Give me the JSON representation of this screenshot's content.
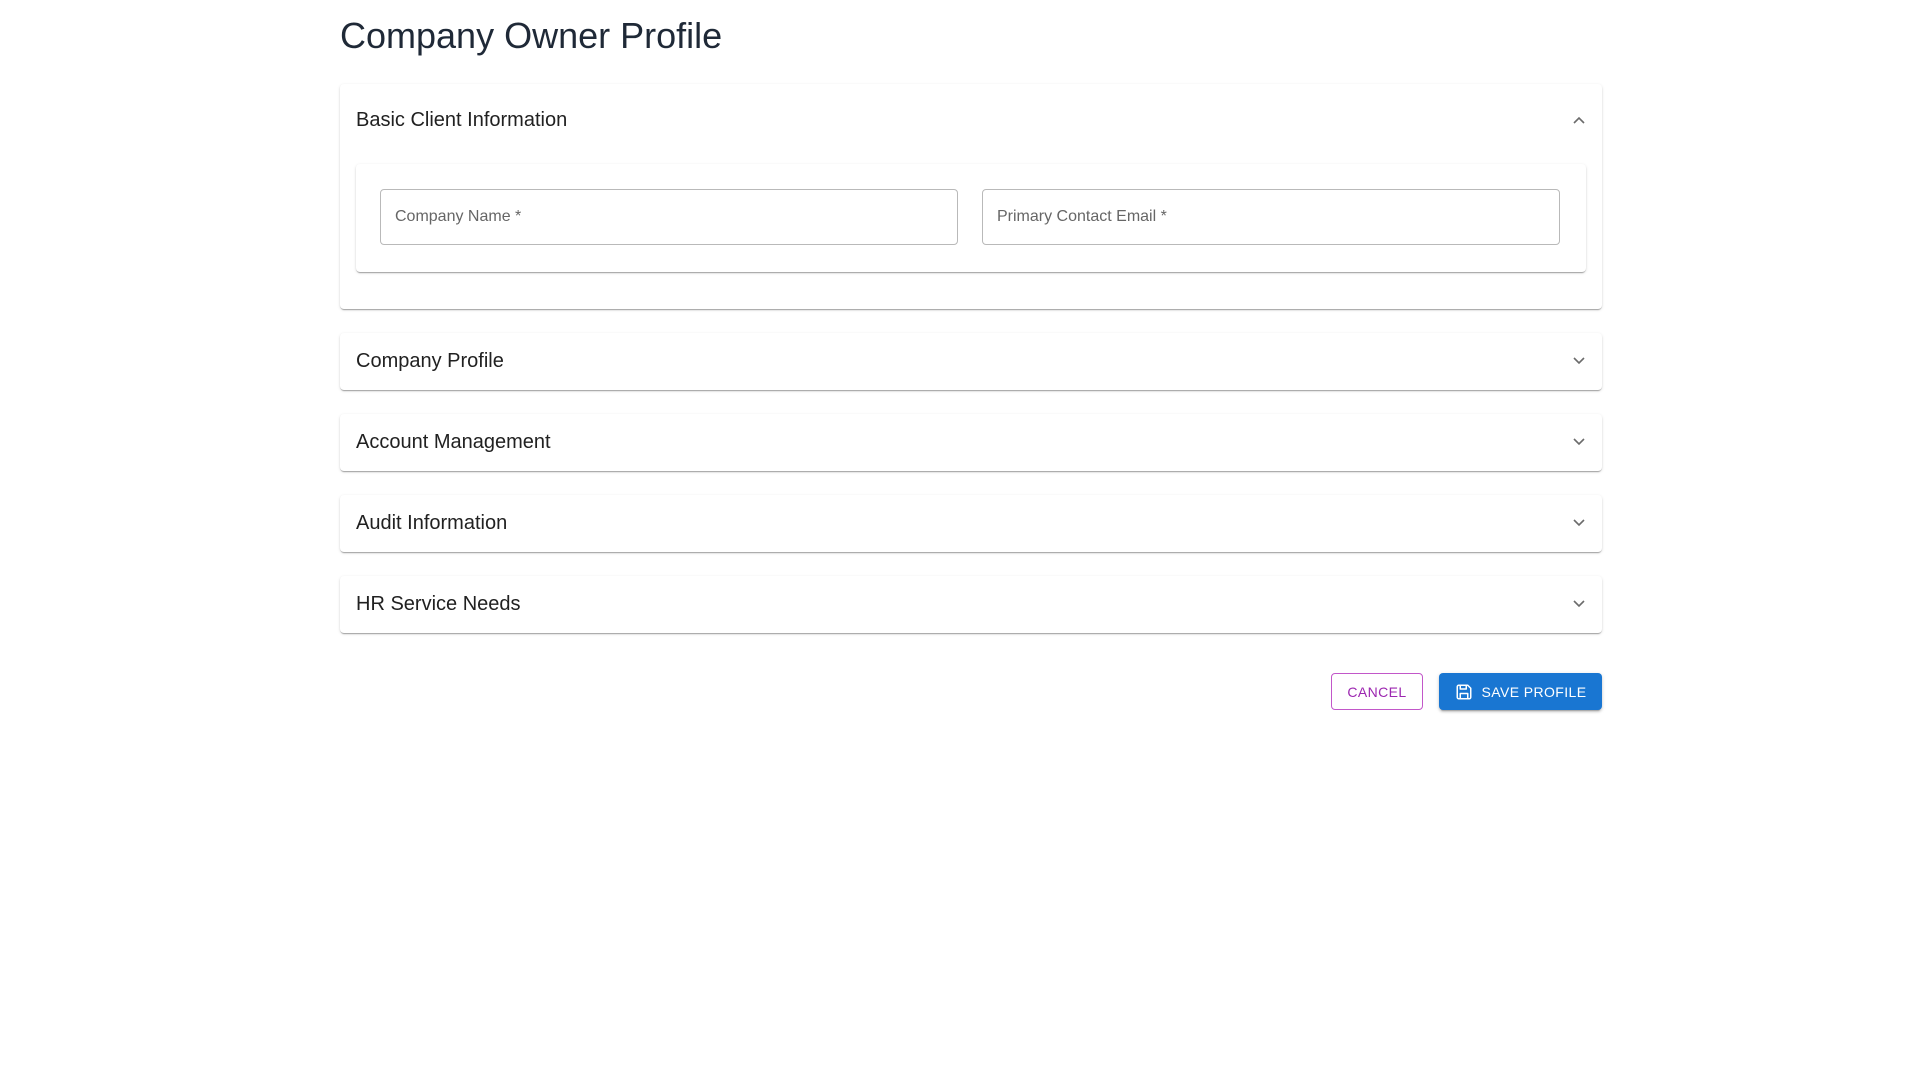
{
  "page": {
    "title": "Company Owner Profile"
  },
  "sections": [
    {
      "title": "Basic Client Information",
      "expanded": true,
      "fields": [
        {
          "label": "Company Name *",
          "value": ""
        },
        {
          "label": "Primary Contact Email *",
          "value": ""
        }
      ]
    },
    {
      "title": "Company Profile",
      "expanded": false
    },
    {
      "title": "Account Management",
      "expanded": false
    },
    {
      "title": "Audit Information",
      "expanded": false
    },
    {
      "title": "HR Service Needs",
      "expanded": false
    }
  ],
  "actions": {
    "cancel_label": "Cancel",
    "save_label": "Save Profile",
    "save_icon": "save-icon"
  },
  "colors": {
    "primary": "#1976d2",
    "secondary": "#9c27b0",
    "title_text": "#1f2937"
  }
}
